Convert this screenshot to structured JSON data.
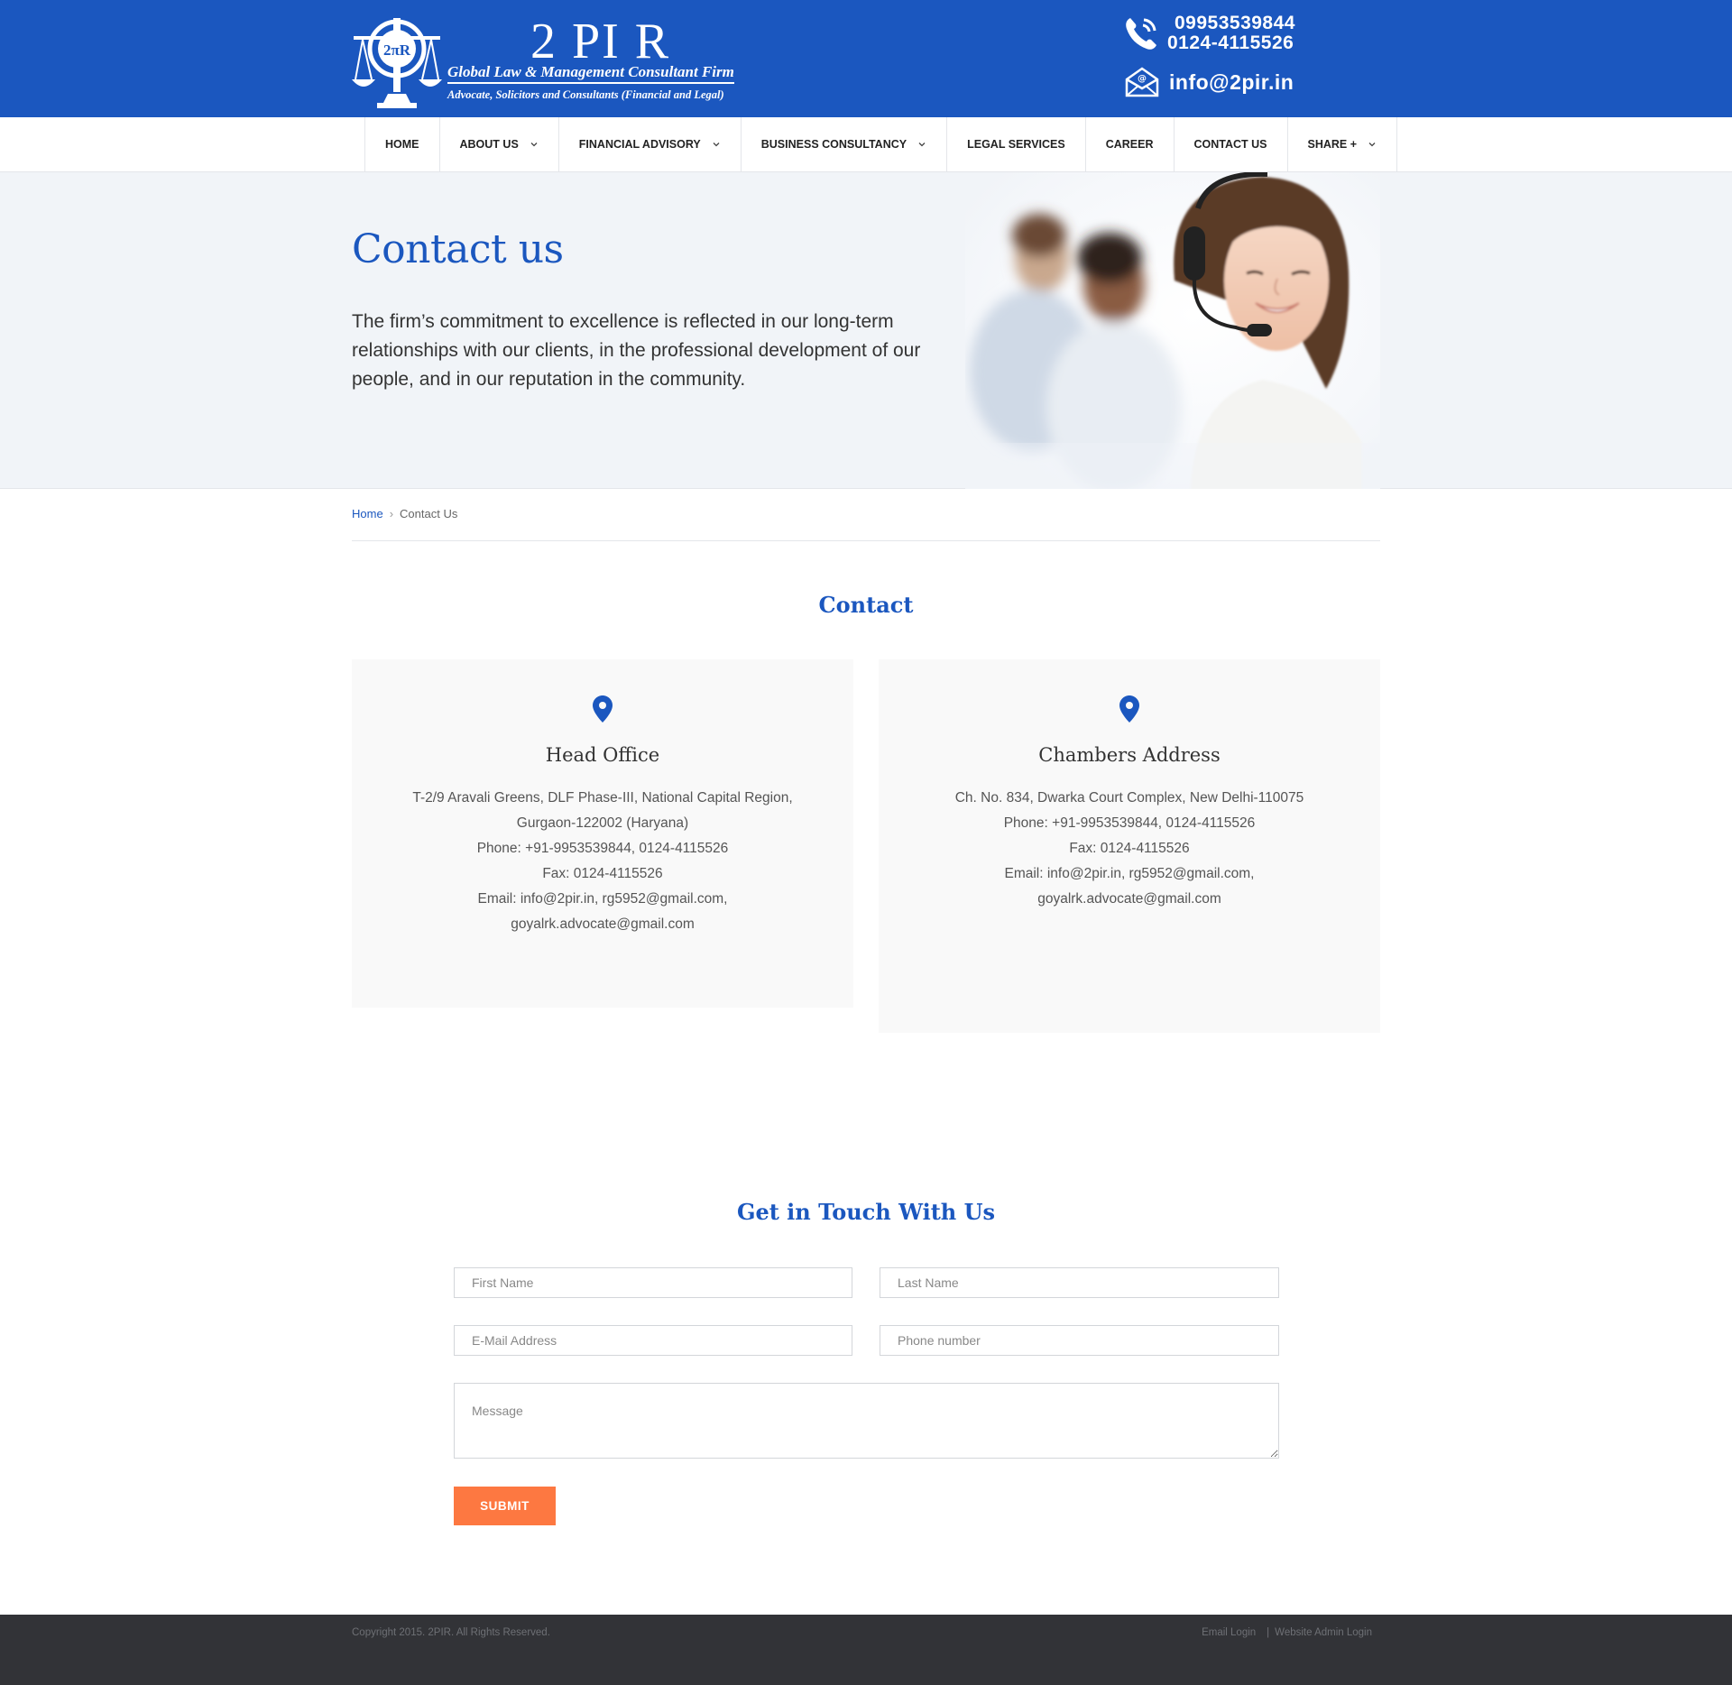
{
  "header": {
    "logo": {
      "emblem_text": "2πR",
      "title": "2 PI R",
      "tagline": "Global Law & Management Consultant Firm",
      "subtagline": "Advocate, Solicitors and Consultants (Financial and Legal)"
    },
    "phone1": "09953539844",
    "phone2": "0124-4115526",
    "email": "info@2pir.in",
    "brand_color": "#1b57bf"
  },
  "nav": {
    "items": [
      {
        "label": "HOME",
        "dropdown": false
      },
      {
        "label": "ABOUT US",
        "dropdown": true
      },
      {
        "label": "FINANCIAL ADVISORY",
        "dropdown": true
      },
      {
        "label": "BUSINESS CONSULTANCY",
        "dropdown": true
      },
      {
        "label": "LEGAL SERVICES",
        "dropdown": false
      },
      {
        "label": "CAREER",
        "dropdown": false
      },
      {
        "label": "CONTACT US",
        "dropdown": false
      },
      {
        "label": "SHARE +",
        "dropdown": true
      }
    ]
  },
  "hero": {
    "title": "Contact us",
    "text": "The firm’s commitment to excellence is reflected in our long-term relationships with our clients, in the professional development of our people, and in our reputation in the community."
  },
  "breadcrumb": {
    "home": "Home",
    "current": "Contact Us"
  },
  "contact": {
    "title": "Contact",
    "cards": [
      {
        "title": "Head Office",
        "lines": [
          "T-2/9 Aravali Greens, DLF Phase-III, National Capital Region,",
          "Gurgaon-122002 (Haryana)",
          "Phone: +91-9953539844, 0124-4115526",
          "Fax: 0124-4115526",
          "Email: info@2pir.in, rg5952@gmail.com,",
          "goyalrk.advocate@gmail.com"
        ]
      },
      {
        "title": "Chambers Address",
        "lines": [
          "Ch. No. 834, Dwarka Court Complex, New Delhi-110075",
          "Phone: +91-9953539844, 0124-4115526",
          "Fax: 0124-4115526",
          "Email: info@2pir.in, rg5952@gmail.com,",
          "goyalrk.advocate@gmail.com"
        ]
      }
    ]
  },
  "form": {
    "title": "Get in Touch With Us",
    "first_name_placeholder": "First Name",
    "last_name_placeholder": "Last Name",
    "email_placeholder": "E-Mail Address",
    "phone_placeholder": "Phone number",
    "message_placeholder": "Message",
    "submit_label": "SUBMIT",
    "submit_color": "#fd7841"
  },
  "footer": {
    "copyright": "Copyright 2015. 2PIR. All Rights Reserved.",
    "email_login": "Email Login",
    "separator": "|",
    "admin_login": "Website Admin Login"
  }
}
